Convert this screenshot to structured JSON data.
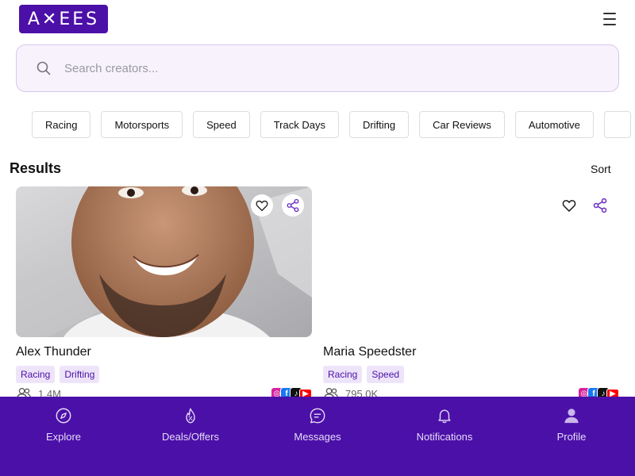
{
  "header": {
    "logo_text": "A✕EES",
    "menu_icon": "hamburger-icon"
  },
  "search": {
    "placeholder": "Search creators...",
    "value": "",
    "icon": "search-icon"
  },
  "categories": [
    "Racing",
    "Motorsports",
    "Speed",
    "Track Days",
    "Drifting",
    "Car Reviews",
    "Automotive"
  ],
  "results": {
    "title": "Results",
    "sort_label": "Sort"
  },
  "creators": [
    {
      "name": "Alex Thunder",
      "tags": [
        "Racing",
        "Drifting"
      ],
      "followers": "1.4M",
      "socials": [
        "instagram-icon",
        "facebook-icon",
        "tiktok-icon",
        "youtube-icon"
      ]
    },
    {
      "name": "Maria Speedster",
      "tags": [
        "Racing",
        "Speed"
      ],
      "followers": "795.0K",
      "socials": [
        "instagram-icon",
        "facebook-icon",
        "tiktok-icon",
        "youtube-icon"
      ]
    }
  ],
  "bottom_nav": [
    {
      "label": "Explore",
      "icon": "compass-icon"
    },
    {
      "label": "Deals/Offers",
      "icon": "deals-icon"
    },
    {
      "label": "Messages",
      "icon": "message-icon"
    },
    {
      "label": "Notifications",
      "icon": "bell-icon"
    },
    {
      "label": "Profile",
      "icon": "person-icon"
    }
  ],
  "colors": {
    "brand": "#4b10a8",
    "tag_bg": "#eee4fa",
    "search_bg": "#f7f2fc"
  }
}
